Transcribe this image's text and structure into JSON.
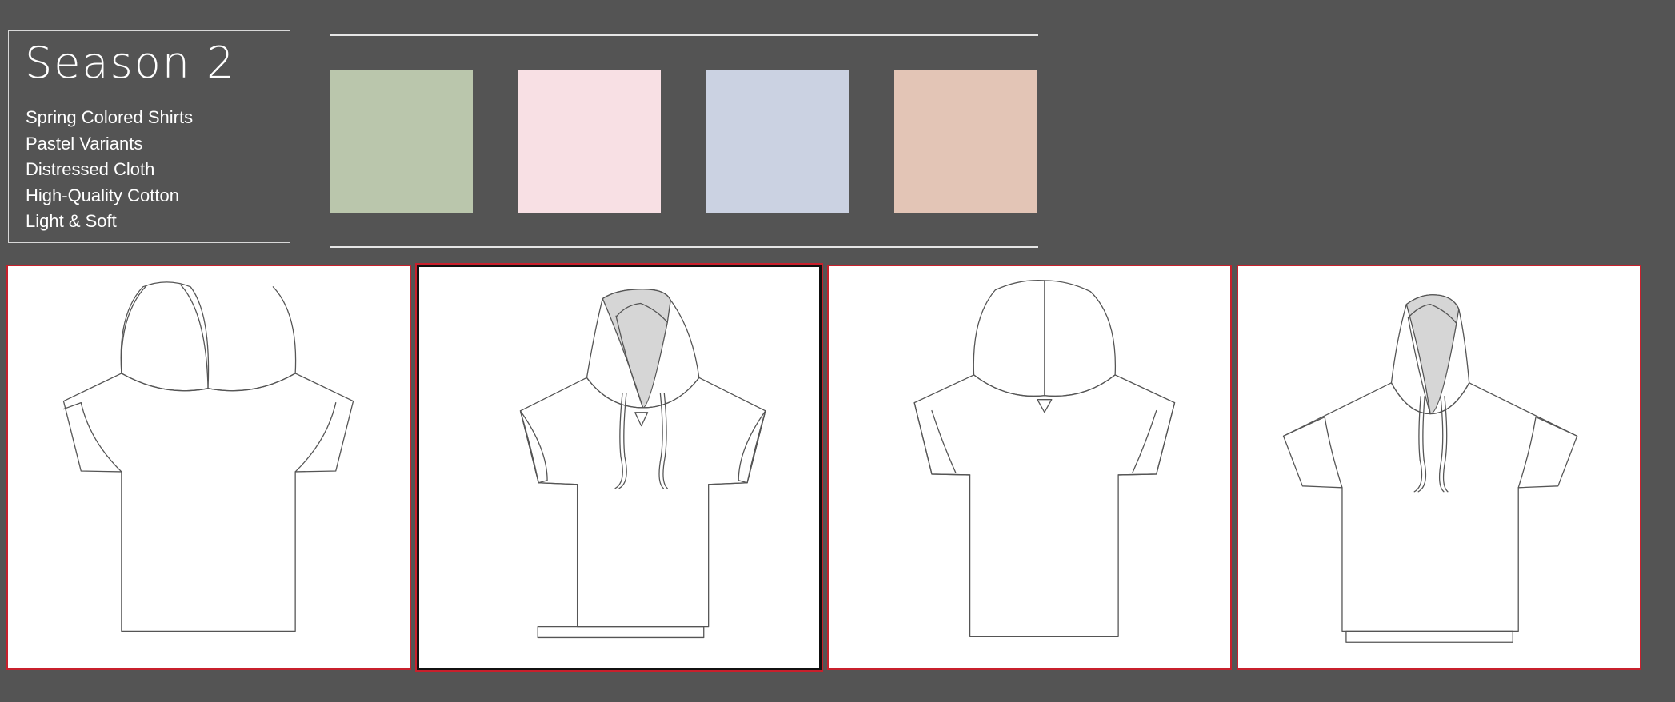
{
  "collection": {
    "title": "Season 2",
    "features": [
      "Spring Colored Shirts",
      "Pastel Variants",
      "Distressed Cloth",
      "High-Quality Cotton",
      "Light & Soft"
    ]
  },
  "palette": {
    "swatches": [
      {
        "name": "sage-green",
        "color": "#bac6ac"
      },
      {
        "name": "blush-pink",
        "color": "#f8e0e4"
      },
      {
        "name": "powder-blue",
        "color": "#cbd2e2"
      },
      {
        "name": "peach-nude",
        "color": "#e3c5b6"
      }
    ]
  },
  "designs": [
    {
      "variant": "plain-hood-no-drawstring",
      "selected": false
    },
    {
      "variant": "lined-hood-with-drawstring-and-hem-band",
      "selected": true
    },
    {
      "variant": "plain-hood-with-triangle-tag",
      "selected": false
    },
    {
      "variant": "lined-hood-with-drawstring-and-hem-band",
      "selected": false
    }
  ],
  "colors": {
    "background": "#545454",
    "panel_border": "#c8202c",
    "selected_border": "#111111"
  }
}
